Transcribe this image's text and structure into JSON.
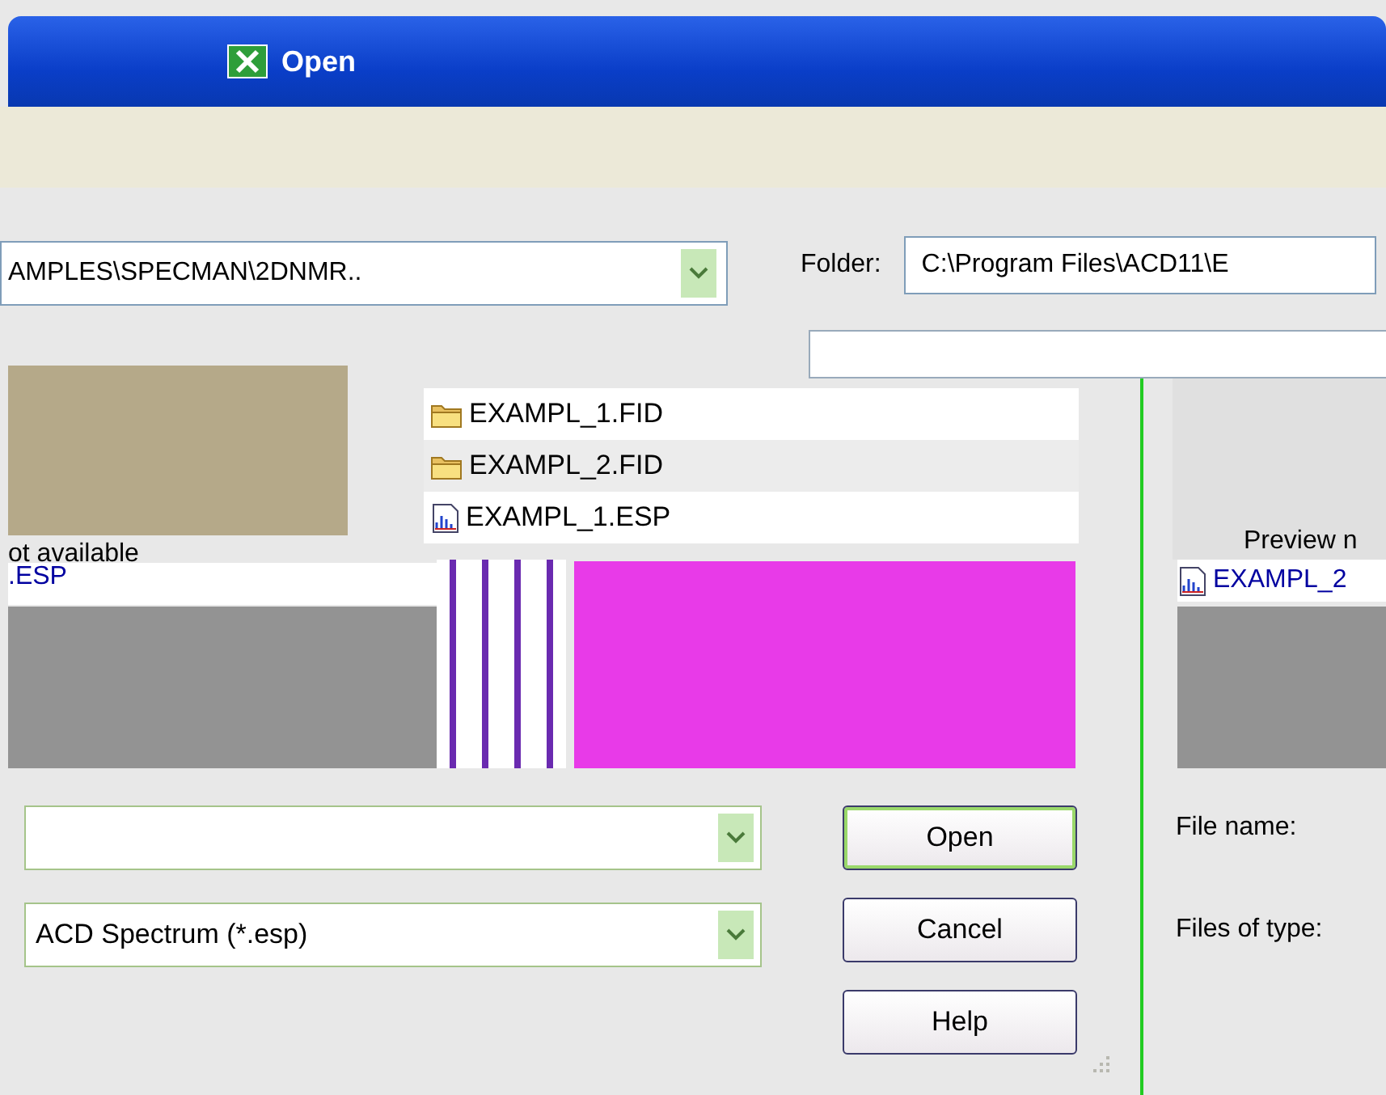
{
  "window": {
    "title": "Open"
  },
  "back_dialog": {
    "folder_label": "Folder:",
    "folder_path": "C:\\Program Files\\ACD11\\E",
    "preview_label": "Preview n",
    "file_item": "EXAMPL_2",
    "file_name_label": "File name:",
    "files_of_type_label": "Files of type:"
  },
  "front_dialog": {
    "look_in_path": "AMPLES\\SPECMAN\\2DNMR..",
    "preview_text": "ot available",
    "preview_file": ".ESP",
    "files": [
      {
        "name": "EXAMPL_1.FID",
        "kind": "folder"
      },
      {
        "name": "EXAMPL_2.FID",
        "kind": "folder"
      },
      {
        "name": "EXAMPL_1.ESP",
        "kind": "spectrum"
      }
    ],
    "file_type": "ACD Spectrum (*.esp)",
    "buttons": [
      "Open",
      "Cancel",
      "Help"
    ]
  }
}
